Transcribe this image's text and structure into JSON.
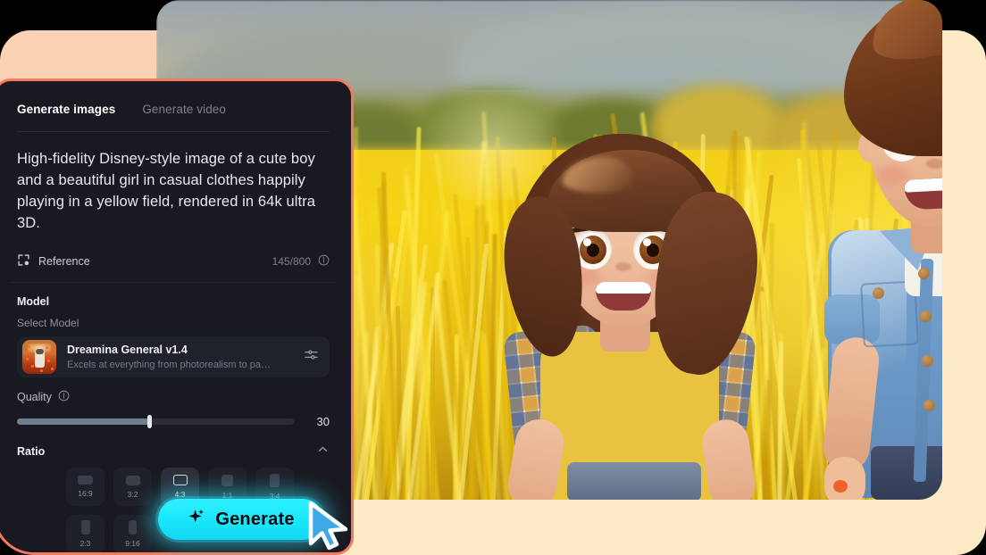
{
  "app": {
    "accent_cyan": "#1fe8fb",
    "panel_border": "#f4795f",
    "panel_bg": "#191a21",
    "cream_card": "#fdeac6"
  },
  "tabs": [
    {
      "label": "Generate images",
      "active": true
    },
    {
      "label": "Generate video",
      "active": false
    }
  ],
  "prompt": {
    "text": "High-fidelity Disney-style image of a cute boy and a beautiful girl in casual clothes happily playing in a yellow field, rendered in 64k ultra 3D.",
    "reference_label": "Reference",
    "reference_icon": "image-reference-icon",
    "counter": "145/800",
    "counter_info_icon": "info-icon"
  },
  "model": {
    "section_title": "Model",
    "select_label": "Select Model",
    "name": "Dreamina General v1.4",
    "description": "Excels at everything from photorealism to painterly…",
    "settings_icon": "sliders-icon",
    "thumbnail": "astronaut-in-poppy-field-thumbnail"
  },
  "quality": {
    "label": "Quality",
    "info_icon": "info-icon",
    "value": "30",
    "fill_percent": 48
  },
  "ratio": {
    "title": "Ratio",
    "collapse_icon": "chevron-up-icon",
    "selected": "4:3",
    "options": [
      {
        "label": "16:9",
        "w": 17,
        "h": 10
      },
      {
        "label": "3:2",
        "w": 16,
        "h": 11
      },
      {
        "label": "4:3",
        "w": 16,
        "h": 12
      },
      {
        "label": "1:1",
        "w": 13,
        "h": 13
      },
      {
        "label": "3:4",
        "w": 11,
        "h": 15
      },
      {
        "label": "2:3",
        "w": 10,
        "h": 16
      },
      {
        "label": "9:16",
        "w": 9,
        "h": 16
      }
    ]
  },
  "generate": {
    "label": "Generate",
    "icon": "sparkle-star-icon"
  },
  "preview": {
    "alt": "disney-style-boy-and-girl-in-yellow-field"
  },
  "cursor": {
    "icon": "mouse-pointer-cursor"
  }
}
